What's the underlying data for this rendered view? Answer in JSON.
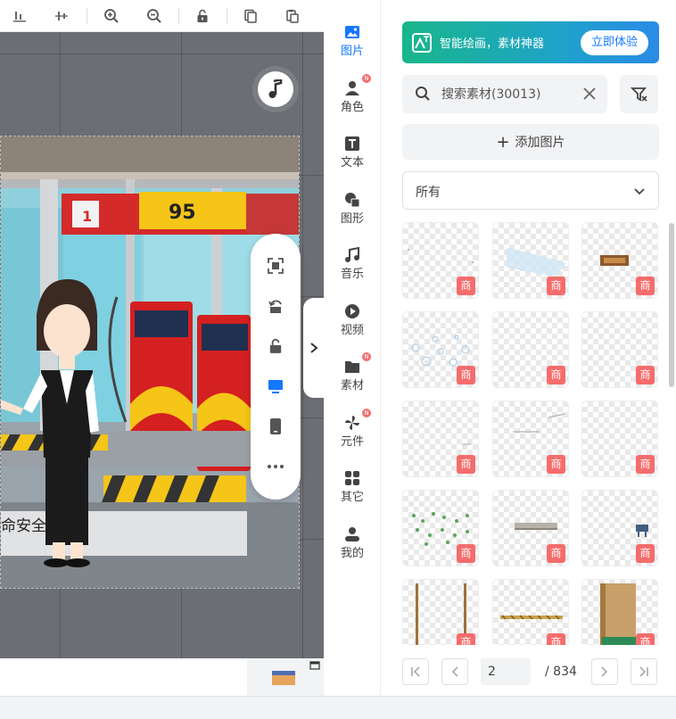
{
  "sidebar": {
    "items": [
      {
        "label": "图片",
        "icon": "image-icon",
        "active": true,
        "badge": ""
      },
      {
        "label": "角色",
        "icon": "character-icon",
        "active": false,
        "badge": "N"
      },
      {
        "label": "文本",
        "icon": "text-icon",
        "active": false,
        "badge": ""
      },
      {
        "label": "图形",
        "icon": "shape-icon",
        "active": false,
        "badge": ""
      },
      {
        "label": "音乐",
        "icon": "music-icon",
        "active": false,
        "badge": ""
      },
      {
        "label": "视频",
        "icon": "video-icon",
        "active": false,
        "badge": ""
      },
      {
        "label": "素材",
        "icon": "folder-icon",
        "active": false,
        "badge": "N"
      },
      {
        "label": "元件",
        "icon": "component-icon",
        "active": false,
        "badge": "N"
      },
      {
        "label": "其它",
        "icon": "grid-icon",
        "active": false,
        "badge": ""
      },
      {
        "label": "我的",
        "icon": "user-icon",
        "active": false,
        "badge": ""
      }
    ]
  },
  "promo": {
    "text": "智能绘画，素材神器",
    "cta": "立即体验"
  },
  "search": {
    "value": "搜索素材(30013)"
  },
  "add_image_label": "添加图片",
  "filter_select": {
    "value": "所有"
  },
  "grid": {
    "tag": "商"
  },
  "pagination": {
    "current": "2",
    "total": "/ 834"
  },
  "scene": {
    "price_1": "1",
    "price_95": "95",
    "subtitle": "命安全"
  },
  "colors": {
    "accent": "#1677ff",
    "tag": "#f56c6c"
  }
}
